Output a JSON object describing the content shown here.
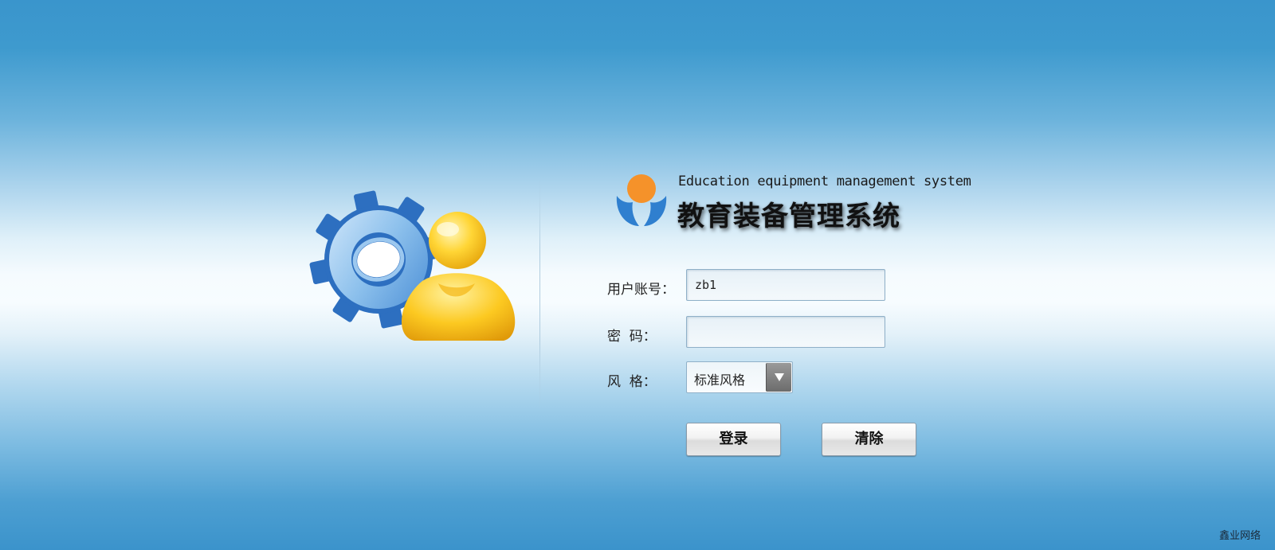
{
  "header": {
    "title_en": "Education equipment management system",
    "title_cn": "教育装备管理系统",
    "logo_icon": "person-logo-icon",
    "illustration_icon": "gear-user-icon"
  },
  "form": {
    "username_label": "用户账号：",
    "username_value": "zb1",
    "password_label": "密  码：",
    "password_value": "",
    "style_label": "风  格：",
    "style_selected": "标准风格",
    "login_button": "登录",
    "clear_button": "清除"
  },
  "footer": {
    "watermark": "鑫业网络"
  },
  "colors": {
    "background_top": "#3a95cc",
    "background_center": "#f7fcff",
    "logo_orange": "#f5922a",
    "logo_blue": "#2f7fcf",
    "gear_blue": "#3478c8",
    "user_yellow": "#f7c21b"
  }
}
